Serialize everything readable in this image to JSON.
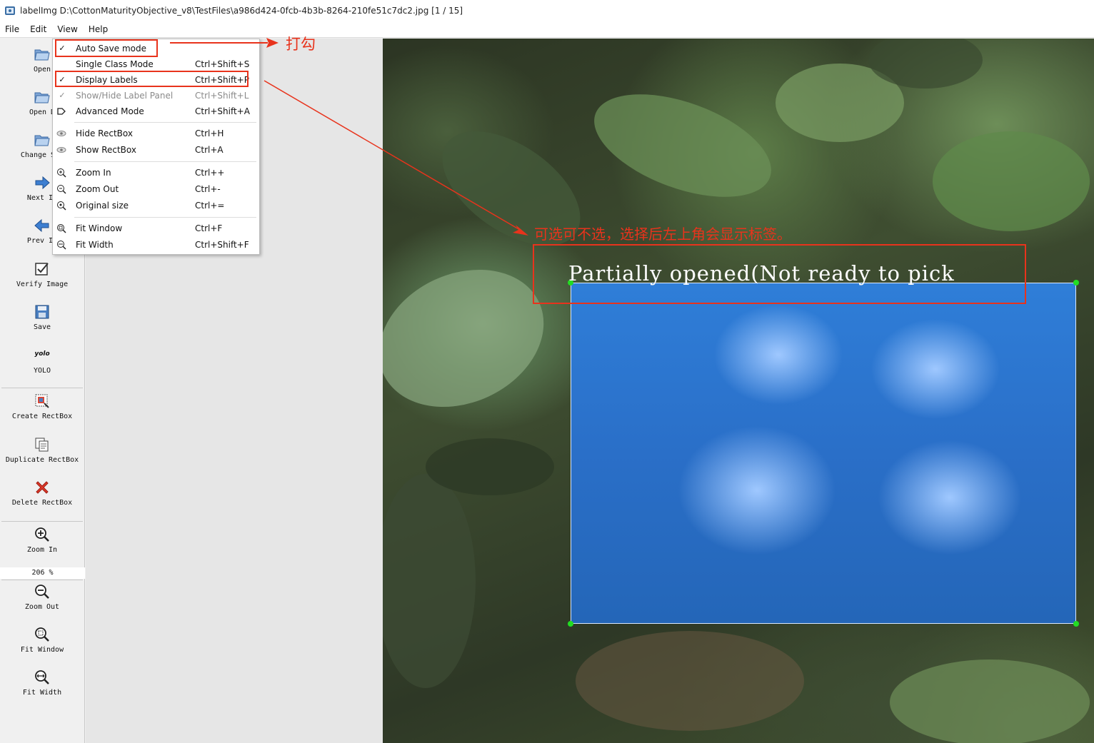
{
  "window": {
    "title": "labelImg D:\\CottonMaturityObjective_v8\\TestFiles\\a986d424-0fcb-4b3b-8264-210fe51c7dc2.jpg [1 / 15]"
  },
  "menubar": {
    "items": [
      "File",
      "Edit",
      "View",
      "Help"
    ]
  },
  "toolbar": {
    "open": "Open",
    "open_dir": "Open D",
    "change_save": "Change Sav",
    "next_image": "Next Im",
    "prev_image": "Prev Im",
    "verify_image": "Verify Image",
    "save": "Save",
    "yolo_icon_text": "yolo",
    "yolo": "YOLO",
    "create_rectbox": "Create RectBox",
    "duplicate_rectbox": "Duplicate RectBox",
    "delete_rectbox": "Delete RectBox",
    "zoom_in": "Zoom In",
    "zoom_value": "206 %",
    "zoom_out": "Zoom Out",
    "fit_window": "Fit Window",
    "fit_width": "Fit Width"
  },
  "view_menu": {
    "items": [
      {
        "label": "Auto Save mode",
        "shortcut": "",
        "checked": true
      },
      {
        "label": "Single Class Mode",
        "shortcut": "Ctrl+Shift+S",
        "checked": false
      },
      {
        "label": "Display Labels",
        "shortcut": "Ctrl+Shift+P",
        "checked": true
      },
      {
        "label": "Show/Hide Label Panel",
        "shortcut": "Ctrl+Shift+L",
        "checked": true,
        "disabled": true
      },
      {
        "label": "Advanced Mode",
        "shortcut": "Ctrl+Shift+A",
        "icon": "advanced-mode-icon"
      },
      {
        "label": "Hide RectBox",
        "shortcut": "Ctrl+H",
        "icon": "eye-icon"
      },
      {
        "label": "Show RectBox",
        "shortcut": "Ctrl+A",
        "icon": "eye-icon"
      },
      {
        "label": "Zoom In",
        "shortcut": "Ctrl++",
        "icon": "zoom-in-icon"
      },
      {
        "label": "Zoom Out",
        "shortcut": "Ctrl+-",
        "icon": "zoom-out-icon"
      },
      {
        "label": "Original size",
        "shortcut": "Ctrl+=",
        "icon": "original-size-icon"
      },
      {
        "label": "Fit Window",
        "shortcut": "Ctrl+F",
        "icon": "fit-window-icon"
      },
      {
        "label": "Fit Width",
        "shortcut": "Ctrl+Shift+F",
        "icon": "fit-width-icon"
      }
    ]
  },
  "annotations": {
    "check_note": "打勾",
    "display_labels_note": "可选可不选，选择后左上角会显示标签。",
    "color": "#e8331c"
  },
  "canvas": {
    "label_text": "Partially opened(Not ready to pick",
    "box_color": "#2a6fc8",
    "handle_color": "#22dd22"
  }
}
